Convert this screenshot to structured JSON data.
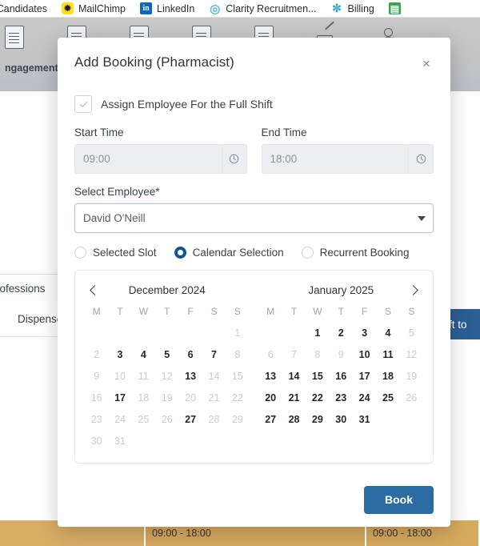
{
  "browser": {
    "bookmarks": [
      {
        "label": "y Candidates",
        "icon": "none-icon"
      },
      {
        "label": "MailChimp",
        "icon": "mailchimp-icon",
        "glyph": "✹"
      },
      {
        "label": "LinkedIn",
        "icon": "linkedin-icon",
        "glyph": "in"
      },
      {
        "label": "Clarity Recruitmen...",
        "icon": "clarity-icon",
        "glyph": "◎"
      },
      {
        "label": "Billing",
        "icon": "billing-icon",
        "glyph": "✼"
      },
      {
        "label": "",
        "icon": "sheets-icon",
        "glyph": "▤"
      }
    ]
  },
  "background": {
    "toolbar_label": "ngagement",
    "left_panel": {
      "header": "Professions",
      "row": "Dispenser, I"
    },
    "right_button": "ift to",
    "slots": [
      {
        "label": ""
      },
      {
        "label": "09:00 - 18:00"
      },
      {
        "label": "09:00 - 18:00"
      }
    ]
  },
  "modal": {
    "title": "Add Booking (Pharmacist)",
    "close_label": "×",
    "full_shift": {
      "label": "Assign Employee For the Full Shift",
      "checked": true
    },
    "start_time": {
      "label": "Start Time",
      "value": "09:00",
      "icon": "clock-icon"
    },
    "end_time": {
      "label": "End Time",
      "value": "18:00",
      "icon": "clock-icon"
    },
    "employee": {
      "label": "Select Employee*",
      "value": "David O'Neill",
      "icon": "chevron-down-icon"
    },
    "booking_mode": {
      "options": [
        {
          "label": "Selected Slot",
          "selected": false
        },
        {
          "label": "Calendar Selection",
          "selected": true
        },
        {
          "label": "Recurrent Booking",
          "selected": false
        }
      ]
    },
    "calendar": {
      "prev_icon": "chevron-left-icon",
      "next_icon": "chevron-right-icon",
      "weekdays": [
        "M",
        "T",
        "W",
        "T",
        "F",
        "S",
        "S"
      ],
      "months": [
        {
          "title": "December 2024",
          "weeks": [
            [
              {
                "d": "",
                "s": "empty"
              },
              {
                "d": "",
                "s": "empty"
              },
              {
                "d": "",
                "s": "empty"
              },
              {
                "d": "",
                "s": "empty"
              },
              {
                "d": "",
                "s": "empty"
              },
              {
                "d": "",
                "s": "empty"
              },
              {
                "d": "1",
                "s": "dim"
              }
            ],
            [
              {
                "d": "2",
                "s": "dim"
              },
              {
                "d": "3",
                "s": "on"
              },
              {
                "d": "4",
                "s": "on"
              },
              {
                "d": "5",
                "s": "on"
              },
              {
                "d": "6",
                "s": "on"
              },
              {
                "d": "7",
                "s": "on"
              },
              {
                "d": "8",
                "s": "dim"
              }
            ],
            [
              {
                "d": "9",
                "s": "dim"
              },
              {
                "d": "10",
                "s": "dim"
              },
              {
                "d": "11",
                "s": "dim"
              },
              {
                "d": "12",
                "s": "dim"
              },
              {
                "d": "13",
                "s": "on"
              },
              {
                "d": "14",
                "s": "dim"
              },
              {
                "d": "15",
                "s": "dim"
              }
            ],
            [
              {
                "d": "16",
                "s": "dim"
              },
              {
                "d": "17",
                "s": "on"
              },
              {
                "d": "18",
                "s": "dim"
              },
              {
                "d": "19",
                "s": "dim"
              },
              {
                "d": "20",
                "s": "dim"
              },
              {
                "d": "21",
                "s": "dim"
              },
              {
                "d": "22",
                "s": "dim"
              }
            ],
            [
              {
                "d": "23",
                "s": "dim"
              },
              {
                "d": "24",
                "s": "dim"
              },
              {
                "d": "25",
                "s": "dim"
              },
              {
                "d": "26",
                "s": "dim"
              },
              {
                "d": "27",
                "s": "on"
              },
              {
                "d": "28",
                "s": "dim"
              },
              {
                "d": "29",
                "s": "dim"
              }
            ],
            [
              {
                "d": "30",
                "s": "dim"
              },
              {
                "d": "31",
                "s": "dim"
              },
              {
                "d": "",
                "s": "empty"
              },
              {
                "d": "",
                "s": "empty"
              },
              {
                "d": "",
                "s": "empty"
              },
              {
                "d": "",
                "s": "empty"
              },
              {
                "d": "",
                "s": "empty"
              }
            ]
          ]
        },
        {
          "title": "January 2025",
          "weeks": [
            [
              {
                "d": "",
                "s": "empty"
              },
              {
                "d": "",
                "s": "empty"
              },
              {
                "d": "1",
                "s": "on"
              },
              {
                "d": "2",
                "s": "on"
              },
              {
                "d": "3",
                "s": "on"
              },
              {
                "d": "4",
                "s": "on"
              },
              {
                "d": "5",
                "s": "dim"
              }
            ],
            [
              {
                "d": "6",
                "s": "dim"
              },
              {
                "d": "7",
                "s": "dim"
              },
              {
                "d": "8",
                "s": "dim"
              },
              {
                "d": "9",
                "s": "dim"
              },
              {
                "d": "10",
                "s": "on"
              },
              {
                "d": "11",
                "s": "on"
              },
              {
                "d": "12",
                "s": "dim"
              }
            ],
            [
              {
                "d": "13",
                "s": "on"
              },
              {
                "d": "14",
                "s": "on"
              },
              {
                "d": "15",
                "s": "on"
              },
              {
                "d": "16",
                "s": "on"
              },
              {
                "d": "17",
                "s": "on"
              },
              {
                "d": "18",
                "s": "on"
              },
              {
                "d": "19",
                "s": "dim"
              }
            ],
            [
              {
                "d": "20",
                "s": "on"
              },
              {
                "d": "21",
                "s": "on"
              },
              {
                "d": "22",
                "s": "on"
              },
              {
                "d": "23",
                "s": "on"
              },
              {
                "d": "24",
                "s": "on"
              },
              {
                "d": "25",
                "s": "on"
              },
              {
                "d": "26",
                "s": "dim"
              }
            ],
            [
              {
                "d": "27",
                "s": "on"
              },
              {
                "d": "28",
                "s": "on"
              },
              {
                "d": "29",
                "s": "on"
              },
              {
                "d": "30",
                "s": "on"
              },
              {
                "d": "31",
                "s": "on"
              },
              {
                "d": "",
                "s": "empty"
              },
              {
                "d": "",
                "s": "empty"
              }
            ],
            [
              {
                "d": "",
                "s": "empty"
              },
              {
                "d": "",
                "s": "empty"
              },
              {
                "d": "",
                "s": "empty"
              },
              {
                "d": "",
                "s": "empty"
              },
              {
                "d": "",
                "s": "empty"
              },
              {
                "d": "",
                "s": "empty"
              },
              {
                "d": "",
                "s": "empty"
              }
            ]
          ]
        }
      ]
    },
    "book_button": "Book"
  },
  "colors": {
    "accent_blue": "#2b6ca3",
    "radio_blue": "#10559a",
    "slot_orange": "#d9ad66",
    "right_btn_blue": "#2b5f94"
  }
}
